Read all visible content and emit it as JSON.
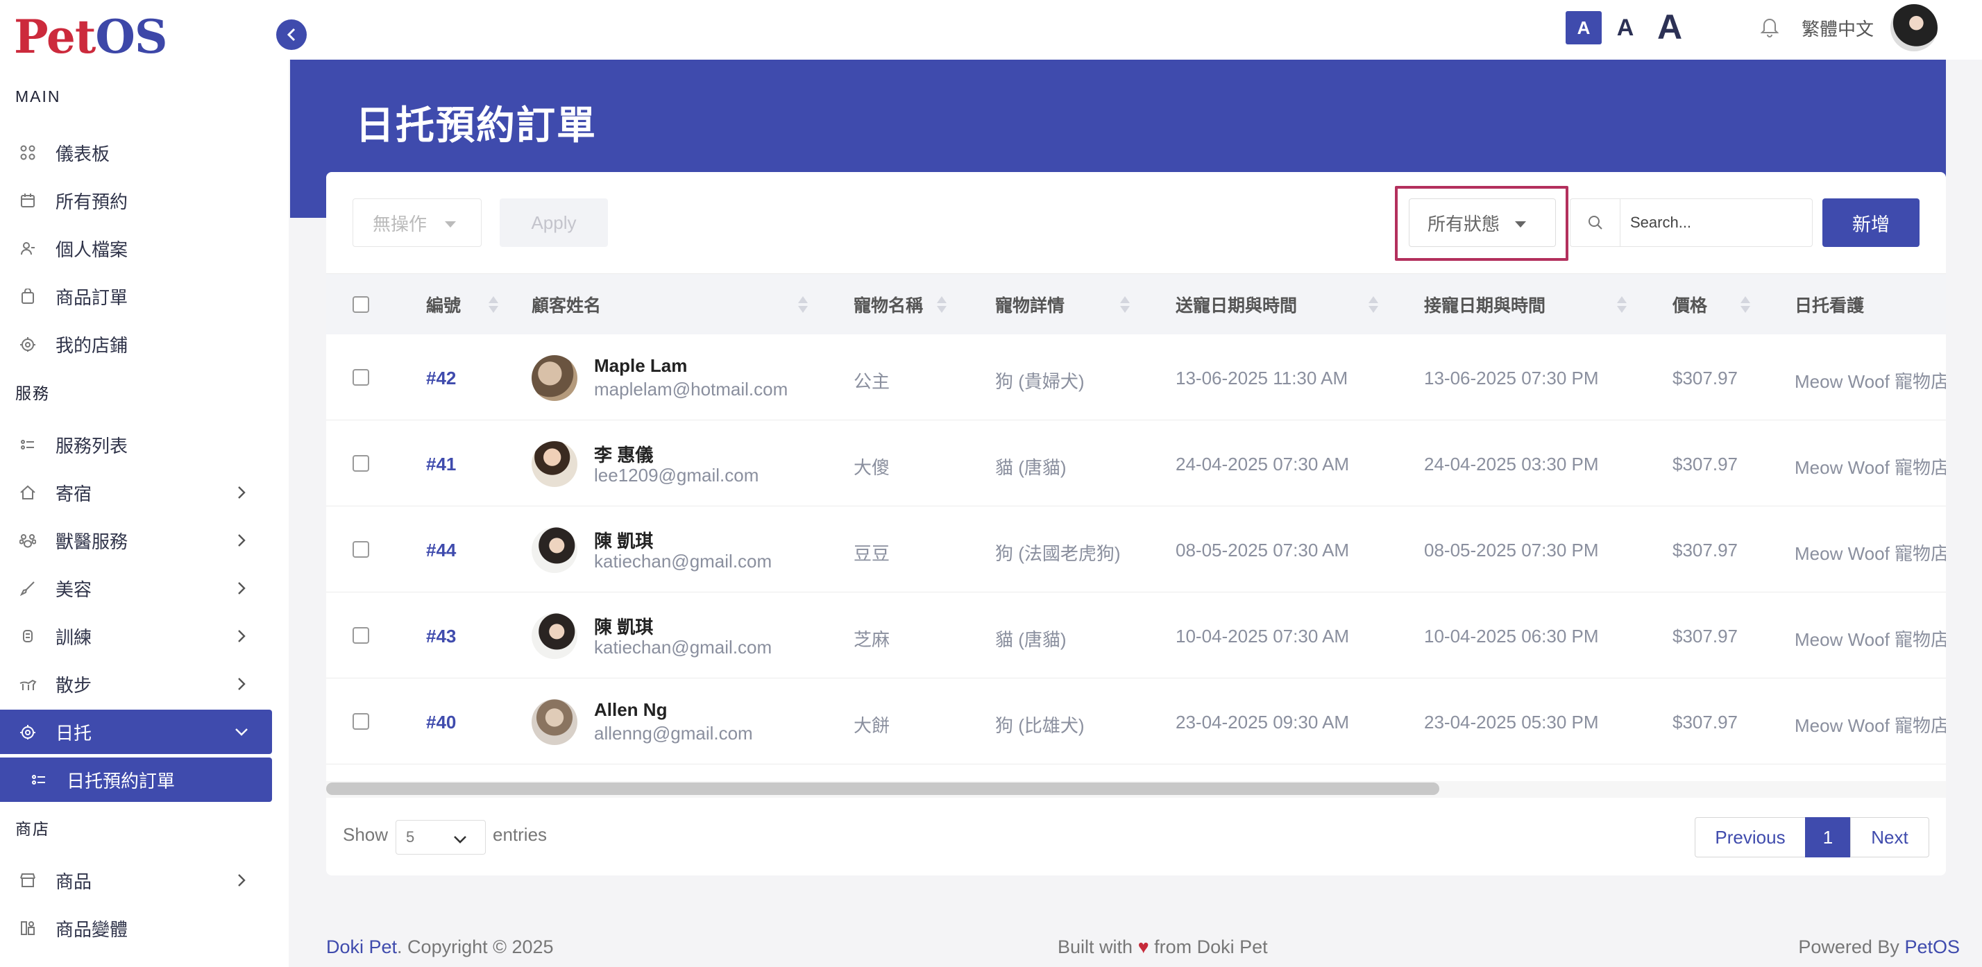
{
  "app": {
    "logo_p": "P",
    "logo_rest": "et",
    "logo_os": "OS"
  },
  "topbar": {
    "font_small": "A",
    "font_mid": "A",
    "font_big": "A",
    "language": "繁體中文"
  },
  "sidebar": {
    "sections": {
      "main": "MAIN",
      "services": "服務",
      "shop": "商店"
    },
    "main_items": [
      {
        "label": "儀表板",
        "icon": "grid-icon"
      },
      {
        "label": "所有預約",
        "icon": "calendar-icon"
      },
      {
        "label": "個人檔案",
        "icon": "user-icon"
      },
      {
        "label": "商品訂單",
        "icon": "bag-icon"
      },
      {
        "label": "我的店鋪",
        "icon": "store-icon"
      }
    ],
    "service_items": [
      {
        "label": "服務列表",
        "icon": "list-icon"
      },
      {
        "label": "寄宿",
        "icon": "home-icon"
      },
      {
        "label": "獸醫服務",
        "icon": "paw-icon"
      },
      {
        "label": "美容",
        "icon": "brush-icon"
      },
      {
        "label": "訓練",
        "icon": "bone-icon"
      },
      {
        "label": "散步",
        "icon": "walk-icon"
      },
      {
        "label": "日托",
        "icon": "daycare-icon"
      },
      {
        "label": "日托預約訂單",
        "icon": "list-icon"
      }
    ],
    "shop_items": [
      {
        "label": "商品",
        "icon": "shop-icon"
      },
      {
        "label": "商品變體",
        "icon": "variant-icon"
      }
    ]
  },
  "page": {
    "title": "日托預約訂單"
  },
  "toolbar": {
    "bulk_action": "無操作",
    "apply": "Apply",
    "status_filter": "所有狀態",
    "search_placeholder": "Search...",
    "add": "新增"
  },
  "table": {
    "columns": [
      "編號",
      "顧客姓名",
      "寵物名稱",
      "寵物詳情",
      "送寵日期與時間",
      "接寵日期與時間",
      "價格",
      "日托看護"
    ],
    "rows": [
      {
        "id": "#42",
        "name": "Maple Lam",
        "email": "maplelam@hotmail.com",
        "pet": "公主",
        "detail": "狗 (貴婦犬)",
        "dropoff": "13-06-2025 11:30 AM",
        "pickup": "13-06-2025 07:30 PM",
        "price": "$307.97",
        "carer": "Meow Woof 寵物店"
      },
      {
        "id": "#41",
        "name": "李 惠儀",
        "email": "lee1209@gmail.com",
        "pet": "大傻",
        "detail": "貓 (唐貓)",
        "dropoff": "24-04-2025 07:30 AM",
        "pickup": "24-04-2025 03:30 PM",
        "price": "$307.97",
        "carer": "Meow Woof 寵物店"
      },
      {
        "id": "#44",
        "name": "陳 凱琪",
        "email": "katiechan@gmail.com",
        "pet": "豆豆",
        "detail": "狗 (法國老虎狗)",
        "dropoff": "08-05-2025 07:30 AM",
        "pickup": "08-05-2025 07:30 PM",
        "price": "$307.97",
        "carer": "Meow Woof 寵物店"
      },
      {
        "id": "#43",
        "name": "陳 凱琪",
        "email": "katiechan@gmail.com",
        "pet": "芝麻",
        "detail": "貓 (唐貓)",
        "dropoff": "10-04-2025 07:30 AM",
        "pickup": "10-04-2025 06:30 PM",
        "price": "$307.97",
        "carer": "Meow Woof 寵物店"
      },
      {
        "id": "#40",
        "name": "Allen Ng",
        "email": "allenng@gmail.com",
        "pet": "大餅",
        "detail": "狗 (比雄犬)",
        "dropoff": "23-04-2025 09:30 AM",
        "pickup": "23-04-2025 05:30 PM",
        "price": "$307.97",
        "carer": "Meow Woof 寵物店"
      }
    ]
  },
  "pagination": {
    "show": "Show",
    "page_size": "5",
    "entries": "entries",
    "previous": "Previous",
    "current": "1",
    "next": "Next"
  },
  "footer": {
    "brand": "Doki Pet",
    "copyright": ". Copyright © 2025",
    "built_pre": "Built with",
    "built_post": "from Doki Pet",
    "powered_pre": "Powered By",
    "powered_brand": "PetOS"
  },
  "colors": {
    "accent": "#3f4bad",
    "brand_red": "#cc2a3c",
    "highlight": "#b3305d"
  }
}
